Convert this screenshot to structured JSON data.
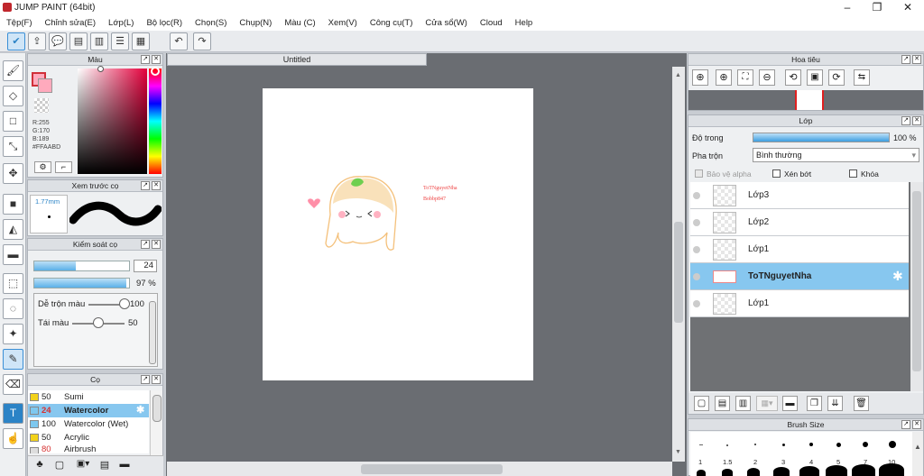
{
  "app": {
    "title": "JUMP PAINT (64bit)"
  },
  "window_controls": {
    "minimize": "–",
    "restore": "❐",
    "close": "✕"
  },
  "menu": [
    "Tệp(F)",
    "Chỉnh sửa(E)",
    "Lớp(L)",
    "Bộ lọc(R)",
    "Chọn(S)",
    "Chụp(N)",
    "Màu (C)",
    "Xem(V)",
    "Công cụ(T)",
    "Cửa sổ(W)",
    "Cloud",
    "Help"
  ],
  "toolbar_icons": [
    "check-icon",
    "upload-icon",
    "comment-icon",
    "message-icon",
    "page-icon",
    "list-icon",
    "grid-icon",
    "undo-icon",
    "redo-icon"
  ],
  "document": {
    "tab": "Untitled",
    "canvas_text_line1": "ToTNguyetNha",
    "canvas_text_line2": "Bobbp847"
  },
  "color_panel": {
    "title": "Màu",
    "r": "R:255",
    "g": "G:170",
    "b": "B:189",
    "hex": "#FFAABD",
    "main_color": "#ffaabd"
  },
  "brush_preview": {
    "title": "Xem trước cọ",
    "size": "1.77mm"
  },
  "brush_control": {
    "title": "Kiểm soát cọ",
    "size": "24",
    "size_fraction": 0.44,
    "opacity": "97 %",
    "opacity_fraction": 0.97,
    "blend_label": "Dễ trộn màu",
    "blend_value": "100",
    "blend_fraction": 1.0,
    "reload_label": "Tái màu",
    "reload_value": "50",
    "reload_fraction": 0.5
  },
  "brush_list": {
    "title": "Cọ",
    "items": [
      {
        "size": "50",
        "name": "Sumi",
        "color": "#f2d21b"
      },
      {
        "size": "24",
        "name": "Watercolor",
        "color": "#7ec8ef",
        "selected": true
      },
      {
        "size": "100",
        "name": "Watercolor (Wet)",
        "color": "#7ec8ef"
      },
      {
        "size": "50",
        "name": "Acrylic",
        "color": "#f2d21b"
      },
      {
        "size": "80",
        "name": "Airbrush",
        "color": "#dddddd"
      }
    ]
  },
  "navigator": {
    "title": "Hoa tiêu"
  },
  "layers": {
    "title": "Lớp",
    "opacity_label": "Độ trong",
    "opacity_value": "100 %",
    "opacity_fraction": 1.0,
    "blend_label": "Pha trộn",
    "blend_value": "Bình thường",
    "protect_alpha": "Bảo vệ alpha",
    "clipping": "Xén bớt",
    "lock": "Khóa",
    "items": [
      {
        "name": "Lớp3",
        "selected": false
      },
      {
        "name": "Lớp2",
        "selected": false
      },
      {
        "name": "Lớp1",
        "selected": false
      },
      {
        "name": "ToTNguyetNha",
        "selected": true
      },
      {
        "name": "Lớp1",
        "selected": false
      }
    ]
  },
  "brush_size": {
    "title": "Brush Size",
    "sizes": [
      "1",
      "1.5",
      "2",
      "3",
      "4",
      "5",
      "7",
      "10"
    ]
  }
}
